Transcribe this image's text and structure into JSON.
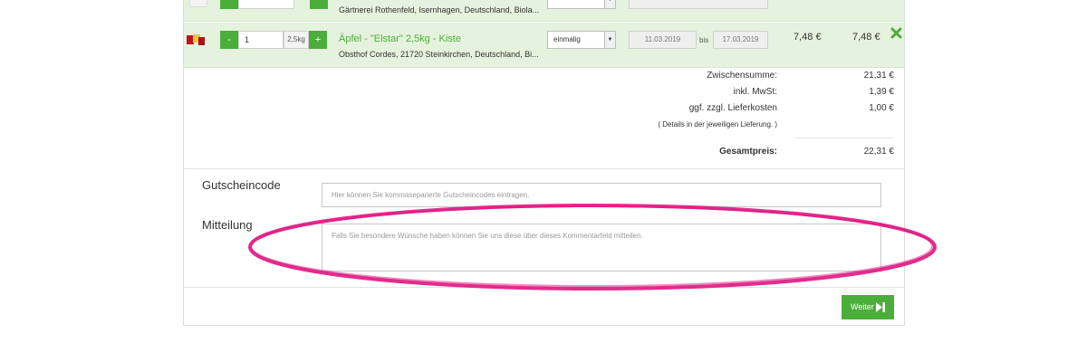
{
  "items": [
    {
      "vendor": "Gärtnerei Rothenfeld, Isernhagen, Deutschland, Biola..."
    },
    {
      "quantity": "1",
      "unit": "2,5kg",
      "name": "Äpfel - \"Elstar\" 2,5kg - Kiste",
      "vendor": "Obsthof Cordes, 21720 Steinkirchen, Deutschland, Bi...",
      "frequency": "einmalig",
      "date_from": "11.03.2019",
      "date_sep": "bis",
      "date_to": "17.03.2019",
      "unit_price": "7,48 €",
      "total_price": "7,48 €",
      "remove_icon": "close-x"
    }
  ],
  "stepper": {
    "minus": "-",
    "plus": "+"
  },
  "totals": {
    "subtotal_label": "Zwischensumme:",
    "subtotal_value": "21,31 €",
    "vat_label": "inkl. MwSt:",
    "vat_value": "1,39 €",
    "delivery_label": "ggf. zzgl. Lieferkosten",
    "delivery_value": "1,00 €",
    "delivery_note": "( Details in der jeweiligen Lieferung. )",
    "total_label": "Gesamtpreis:",
    "total_value": "22,31 €"
  },
  "voucher": {
    "label": "Gutscheincode",
    "placeholder": "Hier können Sie kommaseparierte Gutscheincodes eintragen."
  },
  "message": {
    "label": "Mitteilung",
    "placeholder": "Falls Sie besondere Wünsche haben können Sie uns diese über dieses Kommentarfeld mitteilen."
  },
  "next_button": {
    "label": "Weiter",
    "icon": "skip-forward"
  },
  "colors": {
    "accent": "#4cae3a",
    "row_bg": "#e5f2dd",
    "highlight": "#e0157f"
  }
}
